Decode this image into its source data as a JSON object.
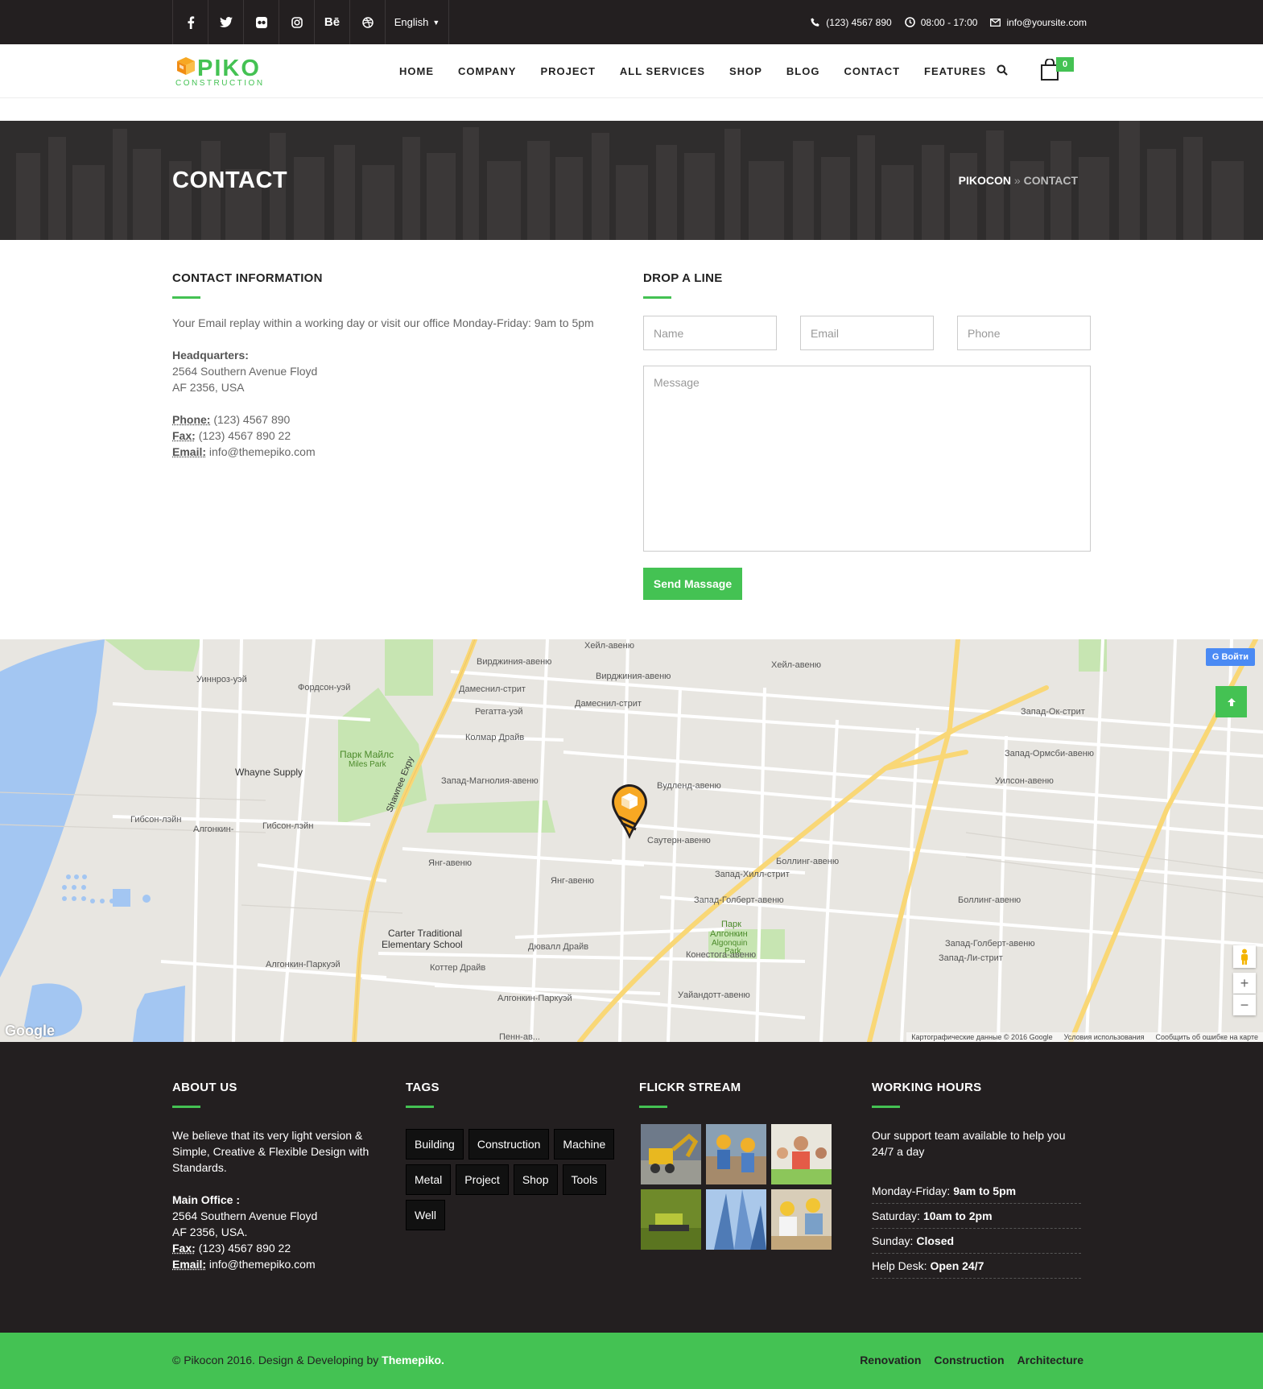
{
  "topbar": {
    "social": [
      "f",
      "t",
      "fl",
      "ig",
      "Bē",
      "dr"
    ],
    "language": "English",
    "phone": "(123) 4567 890",
    "hours": "08:00 - 17:00",
    "email": "info@yoursite.com"
  },
  "header": {
    "logo_name": "PIKO",
    "logo_sub": "CONSTRUCTION",
    "nav": [
      "HOME",
      "COMPANY",
      "PROJECT",
      "ALL SERVICES",
      "SHOP",
      "BLOG",
      "CONTACT",
      "FEATURES"
    ],
    "cart_count": "0"
  },
  "banner": {
    "title": "CONTACT",
    "crumb_home": "PIKOCON",
    "crumb_sep": "»",
    "crumb_current": "CONTACT"
  },
  "contact_info": {
    "title": "CONTACT INFORMATION",
    "intro": "Your Email replay within a working day or visit our office Monday-Friday: 9am to 5pm",
    "hq_label": "Headquarters:",
    "hq_line1": "2564 Southern Avenue Floyd",
    "hq_line2": "AF 2356, USA",
    "phone_label": "Phone:",
    "phone": "(123) 4567 890",
    "fax_label": "Fax:",
    "fax": "(123) 4567 890 22",
    "email_label": "Email:",
    "email": "info@themepiko.com"
  },
  "form": {
    "title": "DROP A LINE",
    "name_ph": "Name",
    "email_ph": "Email",
    "phone_ph": "Phone",
    "message_ph": "Message",
    "send": "Send Massage"
  },
  "map": {
    "signin": "Войти",
    "attribution": [
      "Картографические данные © 2016 Google",
      "Условия использования",
      "Сообщить об ошибке на карте"
    ],
    "labels": {
      "whayne": "Whayne Supply",
      "park_miles": "Парк Майлс",
      "park_miles_en": "Miles Park",
      "carter1": "Carter Traditional",
      "carter2": "Elementary School",
      "park_alg": "Парк",
      "park_alg2": "Алгонкин",
      "park_alg3": "Algonquin",
      "park_alg4": "Park",
      "hail": "Хейл-авеню",
      "hail2": "Хейл-авеню",
      "virginia": "Вирджиния-авеню",
      "virginia2": "Вирджиния-авеню",
      "damesnil": "Дамеснил-стрит",
      "damesnil2": "Дамеснил-стрит",
      "regatta": "Регатта-уэй",
      "kolmar": "Колмар Драйв",
      "magnolia": "Запад-Магнолия-авеню",
      "wudlend": "Вудленд-авеню",
      "southern": "Саутерн-авеню",
      "bolling": "Боллинг-авеню",
      "bolling2": "Боллинг-авеню",
      "westhill": "Запад-Хилл-стрит",
      "golbert": "Запад-Голберт-авеню",
      "golbert2": "Запад-Голберт-авеню",
      "yang": "Янг-авеню",
      "yang2": "Янг-авеню",
      "duvall": "Дювалл Драйв",
      "cotter": "Коттер Драйв",
      "algpkwy": "Алгонкин-Паркуэй",
      "algpkwy2": "Алгонкин-Паркуэй",
      "conestoga": "Конестога-авеню",
      "wyandotte": "Уайандотт-авеню",
      "west_ok": "Запад-Ок-стрит",
      "ormsby": "Запад-Ормсби-авеню",
      "wilson": "Уилсон-авеню",
      "li": "Запад-Ли-стрит",
      "winnroz": "Уиннроз-уэй",
      "fordson": "Фордсон-уэй",
      "gibson": "Гибсон-лэйн",
      "gibson2": "Гибсон-лэйн",
      "algonkin_ln": "Алгонкин-",
      "shawnee": "Shawnee Expy",
      "penn": "Пенн-ав..."
    }
  },
  "footer": {
    "about": {
      "title": "ABOUT US",
      "text": "We believe that its very light version & Simple, Creative & Flexible Design with Standards.",
      "office_label": "Main Office :",
      "line1": "2564 Southern Avenue Floyd",
      "line2": "AF 2356, USA.",
      "fax_label": "Fax:",
      "fax": "(123) 4567 890 22",
      "email_label": "Email:",
      "email": "info@themepiko.com"
    },
    "tags": {
      "title": "TAGS",
      "items": [
        "Building",
        "Construction",
        "Machine",
        "Metal",
        "Project",
        "Shop",
        "Tools",
        "Well"
      ]
    },
    "flickr": {
      "title": "FLICKR STREAM"
    },
    "hours": {
      "title": "WORKING HOURS",
      "text": "Our support team available to help you 24/7 a day",
      "rows": [
        {
          "day": "Monday-Friday:",
          "time": "9am to 5pm"
        },
        {
          "day": "Saturday:",
          "time": "10am to 2pm"
        },
        {
          "day": "Sunday:",
          "time": "Closed"
        },
        {
          "day": "Help Desk:",
          "time": "Open 24/7"
        }
      ]
    }
  },
  "copyright": {
    "text": "© Pikocon 2016. Design & Developing by",
    "brand": "Themepiko.",
    "links": [
      "Renovation",
      "Construction",
      "Architecture"
    ]
  },
  "colors": {
    "accent": "#44c253",
    "dark": "#231f20",
    "google_btn": "#4a8af4"
  }
}
